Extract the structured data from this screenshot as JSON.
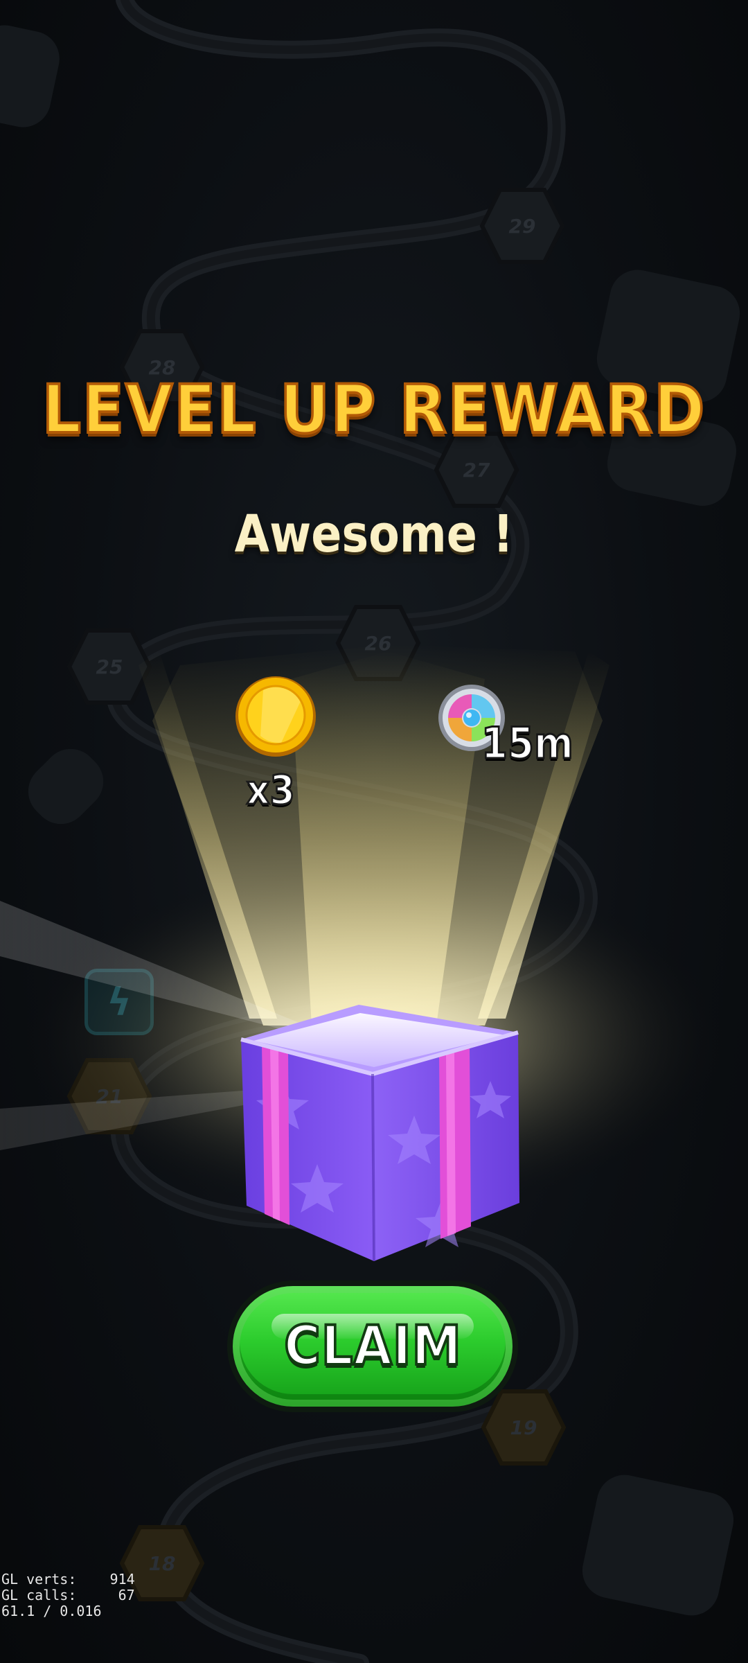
{
  "screen": {
    "title": "LEVEL UP REWARD",
    "subtitle": "Awesome !"
  },
  "rewards": [
    {
      "icon": "gold-coin-icon",
      "amount": "x3"
    },
    {
      "icon": "color-wheel-booster-icon",
      "amount": "15m"
    }
  ],
  "claim_button": {
    "label": "CLAIM"
  },
  "level_map": {
    "nodes": [
      "29",
      "28",
      "27",
      "26",
      "25",
      "21",
      "19",
      "18"
    ]
  },
  "debug": {
    "gl_verts_label": "GL verts:",
    "gl_verts": "914",
    "gl_calls_label": "GL calls:",
    "gl_calls": "67",
    "fps": "61.1 / 0.016"
  },
  "colors": {
    "title": "#ffcf3a",
    "title_outline": "#b25a06",
    "subtitle": "#fbf0c5",
    "claim_green": "#2ccc2d",
    "gift_purple": "#7b4cf0",
    "ribbon_pink": "#e24fd8"
  }
}
